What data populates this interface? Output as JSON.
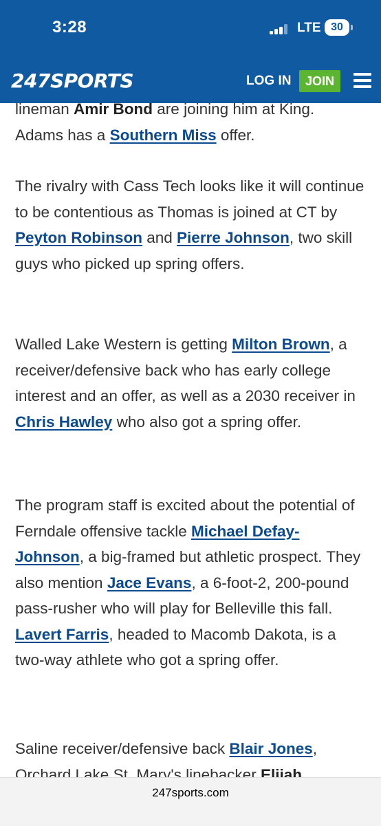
{
  "status_bar": {
    "time": "3:28",
    "network": "LTE",
    "battery": "30"
  },
  "header": {
    "logo": "247SPORTS",
    "login": "LOG IN",
    "join": "JOIN"
  },
  "article": {
    "p0": {
      "t0": "lineman ",
      "s0": "Amir Bond",
      "t1": " are joining him at King.",
      "t2": "Adams has a ",
      "l0": "Southern Miss",
      "t3": " offer."
    },
    "p1": {
      "t0": "The rivalry with Cass Tech looks like it will continue to be contentious as Thomas is joined at CT by ",
      "l0": "Peyton Robinson",
      "t1": " and ",
      "l1": "Pierre Johnson",
      "t2": ", two skill guys who picked up spring offers."
    },
    "p2": {
      "t0": "Walled Lake Western is getting ",
      "l0": "Milton Brown",
      "t1": ", a receiver/defensive back who has early college interest and an offer, as well as a 2030 receiver in ",
      "l1": "Chris Hawley",
      "t2": " who also got a spring offer."
    },
    "p3": {
      "t0": "The program staff is excited about the potential of Ferndale offensive tackle ",
      "l0": "Michael Defay-Johnson",
      "t1": ", a big-framed but athletic prospect. They also mention ",
      "l1": "Jace Evans",
      "t2": ", a 6-foot-2, 200-pound pass-rusher who will play for Belleville this fall. ",
      "l2": "Lavert Farris",
      "t3": ", headed to Macomb Dakota, is a two-way athlete who got a spring offer."
    },
    "p4": {
      "t0": "Saline receiver/defensive back ",
      "l0": "Blair Jones",
      "t1": ", Orchard Lake St. Mary's linebacker ",
      "s0": "Elijah"
    }
  },
  "urlbar": {
    "url": "247sports.com"
  },
  "colors": {
    "header_bg": "#0f5aa0",
    "join_bg": "#5cb531",
    "link": "#0b4a8f"
  }
}
